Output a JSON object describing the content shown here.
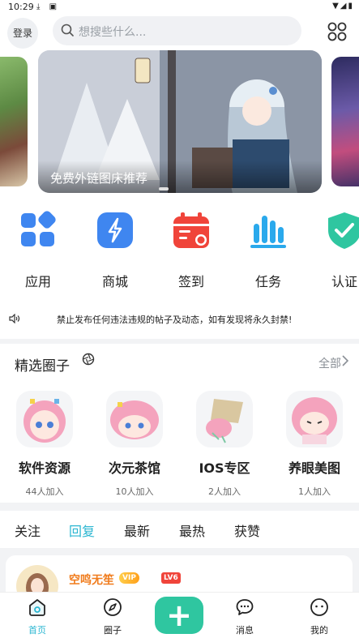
{
  "status_bar": {
    "time": "10:29"
  },
  "header": {
    "login_label": "登录",
    "search_placeholder": "想搜些什么..."
  },
  "banner": {
    "caption": "免费外链图床推荐"
  },
  "quick_links": [
    {
      "label": "应用",
      "icon": "apps-grid-icon",
      "color": "#3f86f0"
    },
    {
      "label": "商城",
      "icon": "lightning-icon",
      "color": "#3f86f0"
    },
    {
      "label": "签到",
      "icon": "calendar-icon",
      "color": "#f0443a"
    },
    {
      "label": "任务",
      "icon": "bar-chart-icon",
      "color": "#2aa9ec"
    },
    {
      "label": "认证",
      "icon": "shield-check-icon",
      "color": "#2fc6a0"
    }
  ],
  "notice": {
    "text": "禁止发布任何违法违规的帖子及动态，如有发现将永久封禁!"
  },
  "circles": {
    "title": "精选圈子",
    "more_label": "全部",
    "items": [
      {
        "name": "软件资源",
        "count": "44人加入"
      },
      {
        "name": "次元茶馆",
        "count": "10人加入"
      },
      {
        "name": "IOS专区",
        "count": "2人加入"
      },
      {
        "name": "养眼美图",
        "count": "1人加入"
      }
    ]
  },
  "tabs": [
    {
      "label": "关注",
      "active": false
    },
    {
      "label": "回复",
      "active": true
    },
    {
      "label": "最新",
      "active": false
    },
    {
      "label": "最热",
      "active": false
    },
    {
      "label": "获赞",
      "active": false
    }
  ],
  "post": {
    "user_name": "空鸣无笙",
    "vip_badge": "VIP",
    "level_badge": "LV6"
  },
  "bottom_nav": [
    {
      "label": "首页",
      "icon": "home-icon",
      "active": true
    },
    {
      "label": "圈子",
      "icon": "compass-icon",
      "active": false
    },
    {
      "label": "消息",
      "icon": "chat-bubble-icon",
      "active": false
    },
    {
      "label": "我的",
      "icon": "profile-face-icon",
      "active": false
    }
  ],
  "colors": {
    "accent": "#2bb6d1",
    "publish_button": "#2fc6a0",
    "username": "#f07c1d"
  }
}
